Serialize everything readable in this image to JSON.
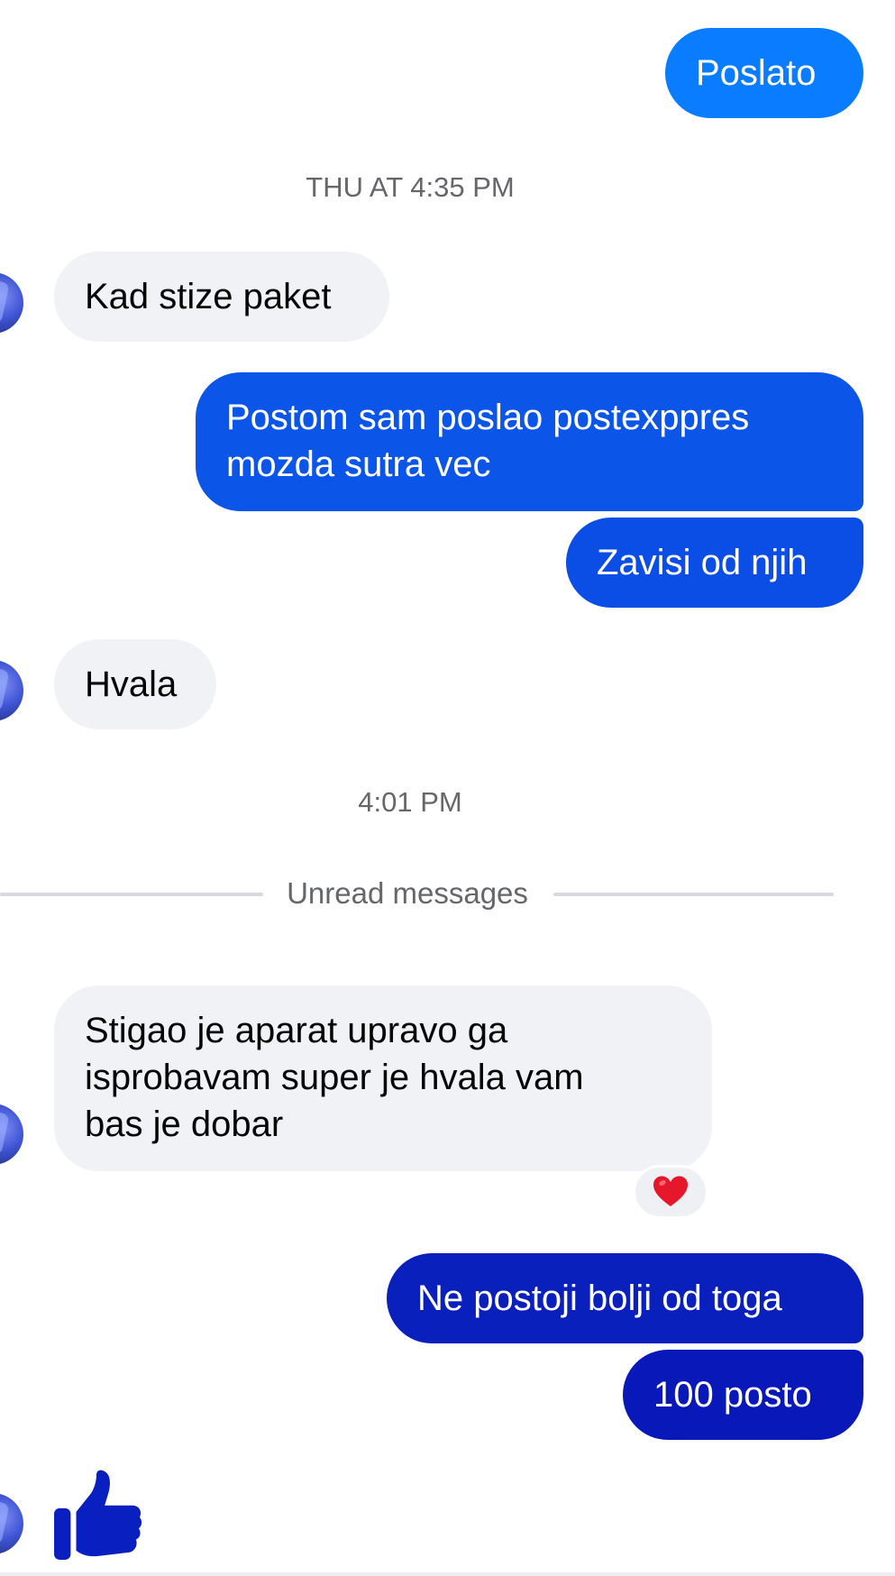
{
  "thread": {
    "msg_poslato": "Poslato",
    "timestamp_1": "THU AT 4:35 PM",
    "msg_kad_stize": "Kad stize paket",
    "msg_postom_line1": "Postom sam poslao postexppres",
    "msg_postom_line2": "mozda sutra vec",
    "msg_zavisi": "Zavisi od njih",
    "msg_hvala": "Hvala",
    "timestamp_2": "4:01 PM",
    "unread_divider": "Unread messages",
    "msg_stigao_line1": "Stigao je aparat upravo ga",
    "msg_stigao_line2": "isprobavam super je hvala vam",
    "msg_stigao_line3": "bas je dobar",
    "reaction_icon": "red-heart-icon",
    "msg_ne_postoji": "Ne postoji bolji od toga",
    "msg_100": "100 posto",
    "like_icon": "thumbs-up-icon"
  },
  "colors": {
    "incoming_bubble": "#f1f2f6",
    "outgoing_top": "#0a7cff",
    "outgoing_mid": "#0b4fe6",
    "outgoing_bottom": "#0918b8",
    "timestamp_text": "#65676b",
    "heart": "#e6172b",
    "like": "#0a1fc0"
  }
}
